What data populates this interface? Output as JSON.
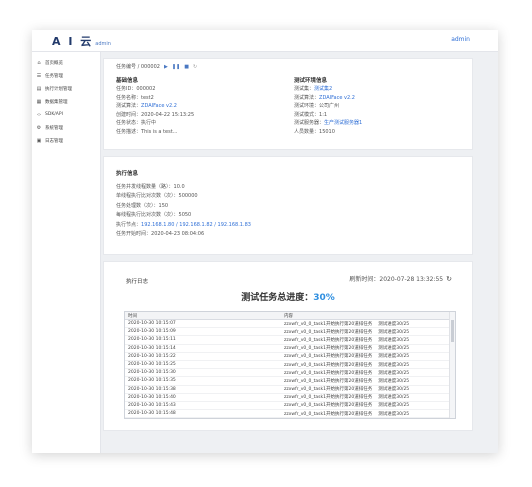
{
  "header": {
    "logo_text": "A I 云",
    "logo_sub": "admin",
    "user": "admin"
  },
  "sidebar": {
    "items": [
      {
        "icon": "home-icon",
        "glyph": "⌂",
        "label": "首页概览"
      },
      {
        "icon": "task-icon",
        "glyph": "☰",
        "label": "任务管理"
      },
      {
        "icon": "plan-icon",
        "glyph": "▤",
        "label": "执行计划管理"
      },
      {
        "icon": "data-icon",
        "glyph": "▦",
        "label": "数据集管理"
      },
      {
        "icon": "code-icon",
        "glyph": "‹›",
        "label": "SDK/API"
      },
      {
        "icon": "system-icon",
        "glyph": "⚙",
        "label": "系统管理"
      },
      {
        "icon": "log-icon",
        "glyph": "▣",
        "label": "日志管理"
      }
    ]
  },
  "task": {
    "breadcrumb": "任务编号 / 000002",
    "basic_title": "基础信息",
    "basic": [
      {
        "k": "任务ID：",
        "v": "000002",
        "link": false
      },
      {
        "k": "任务名称：",
        "v": "test2",
        "link": false
      },
      {
        "k": "测试算法：",
        "v": "ZDAIFace v2.2",
        "link": true
      },
      {
        "k": "创建时间：",
        "v": "2020-04-22 15:13:25",
        "link": false
      },
      {
        "k": "任务状态：",
        "v": "执行中",
        "link": false
      },
      {
        "k": "任务描述：",
        "v": "This is a test...",
        "link": false
      }
    ],
    "env_title": "测试环境信息",
    "env": [
      {
        "k": "测试集：",
        "v": "测试集2",
        "link": true
      },
      {
        "k": "测试算法：",
        "v": "ZDAIFace v2.2",
        "link": true
      },
      {
        "k": "测试环境：",
        "v": "公司广州",
        "link": false
      },
      {
        "k": "测试模式：",
        "v": "1:1",
        "link": false
      },
      {
        "k": "测试服务器：",
        "v": "生产测试服务器1",
        "link": true
      },
      {
        "k": "人员数量：",
        "v": "15010",
        "link": false
      }
    ]
  },
  "exec": {
    "title": "执行信息",
    "items": [
      {
        "k": "任务并发线程数量（路）：",
        "v": "10.0",
        "link": false
      },
      {
        "k": "单线程执行比对次数（次）：",
        "v": "500000",
        "link": false
      },
      {
        "k": "任务处理数（次）：",
        "v": "150",
        "link": false
      },
      {
        "k": "每线程执行比对次数（次）：",
        "v": "5050",
        "link": false
      },
      {
        "k": "执行节点：",
        "v": "192.168.1.80 / 192.168.1.82 / 192.168.1.83",
        "link": true
      },
      {
        "k": "任务开始时间：",
        "v": "2020-04-23 08:04:06",
        "link": false
      }
    ]
  },
  "log": {
    "title": "执行日志",
    "refresh_label": "刷新时间：2020-07-28 13:32:55",
    "progress_label": "测试任务总进度：",
    "progress_value": "30%",
    "progress": 0.3,
    "columns": [
      "时间",
      "内容"
    ],
    "rows": [
      {
        "time": "2020-10-30 10:15:07",
        "msg": "zzxwfr_v0_0_task1开始执行第20道排任务",
        "status": "测试进度30/25"
      },
      {
        "time": "2020-10-30 10:15:09",
        "msg": "zzxwfr_v0_0_task1开始执行第20道排任务",
        "status": "测试进度30/25"
      },
      {
        "time": "2020-10-30 10:15:11",
        "msg": "zzxwfr_v0_0_task1开始执行第20道排任务",
        "status": "测试进度30/25"
      },
      {
        "time": "2020-10-30 10:15:14",
        "msg": "zzxwfr_v0_0_task1开始执行第20道排任务",
        "status": "测试进度30/25"
      },
      {
        "time": "2020-10-30 10:15:22",
        "msg": "zzxwfr_v0_0_task1开始执行第20道排任务",
        "status": "测试进度30/25"
      },
      {
        "time": "2020-10-30 10:15:25",
        "msg": "zzxwfr_v0_0_task1开始执行第20道排任务",
        "status": "测试进度30/25"
      },
      {
        "time": "2020-10-30 10:15:30",
        "msg": "zzxwfr_v0_0_task1开始执行第20道排任务",
        "status": "测试进度30/25"
      },
      {
        "time": "2020-10-30 10:15:35",
        "msg": "zzxwfr_v0_0_task1开始执行第20道排任务",
        "status": "测试进度30/25"
      },
      {
        "time": "2020-10-30 10:15:38",
        "msg": "zzxwfr_v0_0_task1开始执行第20道排任务",
        "status": "测试进度30/25"
      },
      {
        "time": "2020-10-30 10:15:40",
        "msg": "zzxwfr_v0_0_task1开始执行第20道排任务",
        "status": "测试进度30/25"
      },
      {
        "time": "2020-10-30 10:15:43",
        "msg": "zzxwfr_v0_0_task1开始执行第20道排任务",
        "status": "测试进度30/25"
      },
      {
        "time": "2020-10-30 10:15:48",
        "msg": "zzxwfr_v0_0_task1开始执行第20道排任务",
        "status": "测试进度30/25"
      },
      {
        "time": "2020-10-30 10:15:50",
        "msg": "zzxwfr_v0_0_task1开始执行第20道排任务",
        "status": "测试进度30/25"
      }
    ]
  }
}
